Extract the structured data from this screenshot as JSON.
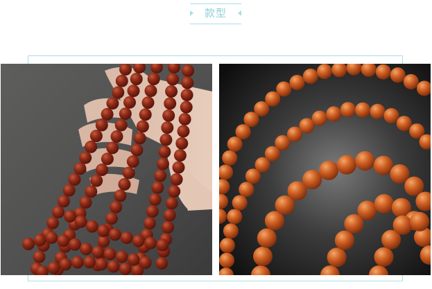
{
  "section": {
    "title": "款型"
  },
  "photos": [
    {
      "icon": "red-bead-necklace-in-hand-photo"
    },
    {
      "icon": "orange-bead-necklace-closeup-photo"
    }
  ],
  "colors": {
    "accent": "#a9dde4",
    "title": "#8fd0d9",
    "bead_red": "#8a2414",
    "bead_orange": "#c8561f"
  }
}
